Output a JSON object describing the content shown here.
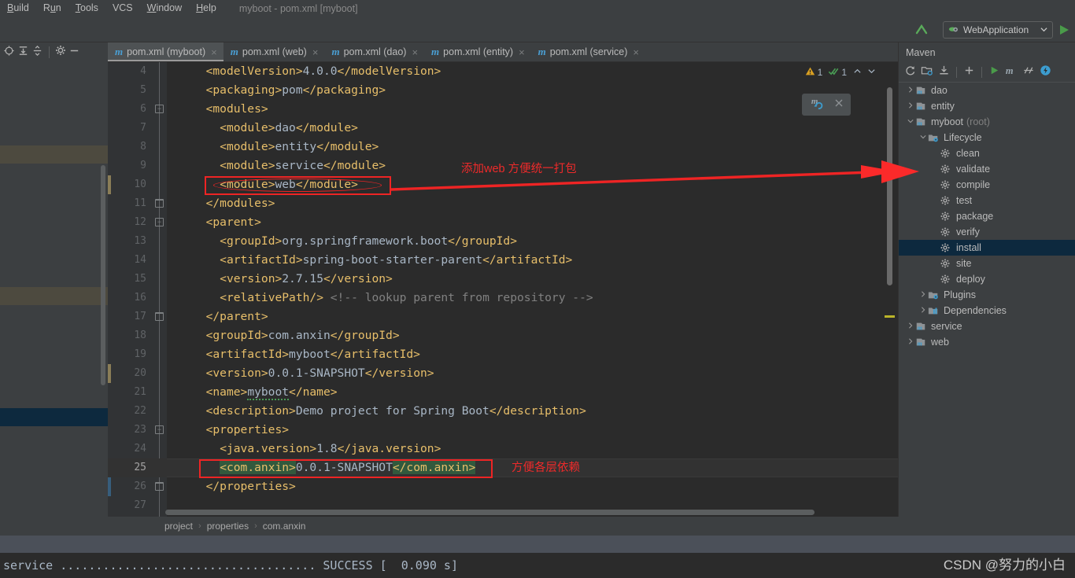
{
  "window": {
    "title": "myboot - pom.xml [myboot]",
    "menu": [
      "Build",
      "Run",
      "Tools",
      "VCS",
      "Window",
      "Help"
    ]
  },
  "toolbar": {
    "run_config": "WebApplication",
    "run_config_icon": "tomcat-icon",
    "dropdown_icon": "chevron-down-icon",
    "run_icon": "run-triangle-icon",
    "update_icon": "update-arrow-icon"
  },
  "left_toolbar": {
    "icons": [
      "locate-target-icon",
      "expand-all-icon",
      "collapse-all-icon",
      "gear-icon",
      "minimize-icon"
    ]
  },
  "editor_tabs": [
    {
      "label": "pom.xml (myboot)",
      "icon": "maven-m-icon",
      "active": true
    },
    {
      "label": "pom.xml (web)",
      "icon": "maven-m-icon",
      "active": false
    },
    {
      "label": "pom.xml (dao)",
      "icon": "maven-m-icon",
      "active": false
    },
    {
      "label": "pom.xml (entity)",
      "icon": "maven-m-icon",
      "active": false
    },
    {
      "label": "pom.xml (service)",
      "icon": "maven-m-icon",
      "active": false
    }
  ],
  "inspection": {
    "warning_icon": "warning-triangle-icon",
    "warning_count": "1",
    "ok_icon": "inspection-check-icon",
    "ok_count": "1",
    "prev_icon": "chevron-up-icon",
    "next_icon": "chevron-down-icon"
  },
  "maven_popup": {
    "reload_icon": "maven-reload-icon",
    "close_icon": "close-icon"
  },
  "code": {
    "first_line_number": 4,
    "lines": [
      {
        "n": 4,
        "indent": 2,
        "html": "<span class='tag'>&lt;modelVersion&gt;</span><span class='txt'>4.0.0</span><span class='tag'>&lt;/modelVersion&gt;</span>",
        "text": "<modelVersion>4.0.0</modelVersion>"
      },
      {
        "n": 5,
        "indent": 2,
        "html": "<span class='tag'>&lt;packaging&gt;</span><span class='txt'>pom</span><span class='tag'>&lt;/packaging&gt;</span>",
        "text": "<packaging>pom</packaging>"
      },
      {
        "n": 6,
        "indent": 2,
        "fold": "minus",
        "html": "<span class='tag'>&lt;modules&gt;</span>",
        "text": "<modules>"
      },
      {
        "n": 7,
        "indent": 4,
        "html": "<span class='tag'>&lt;module&gt;</span><span class='txt'>dao</span><span class='tag'>&lt;/module&gt;</span>",
        "text": "<module>dao</module>"
      },
      {
        "n": 8,
        "indent": 4,
        "html": "<span class='tag'>&lt;module&gt;</span><span class='txt'>entity</span><span class='tag'>&lt;/module&gt;</span>",
        "text": "<module>entity</module>"
      },
      {
        "n": 9,
        "indent": 4,
        "html": "<span class='tag'>&lt;module&gt;</span><span class='txt'>service</span><span class='tag'>&lt;/module&gt;</span>",
        "text": "<module>service</module>"
      },
      {
        "n": 10,
        "indent": 4,
        "html": "<span class='tag'>&lt;module&gt;</span><span class='txt'>web</span><span class='tag'>&lt;/module&gt;</span>",
        "text": "<module>web</module>"
      },
      {
        "n": 11,
        "indent": 2,
        "fold": "end",
        "html": "<span class='tag'>&lt;/modules&gt;</span>",
        "text": "</modules>"
      },
      {
        "n": 12,
        "indent": 2,
        "fold": "minus",
        "html": "<span class='tag'>&lt;parent&gt;</span>",
        "text": "<parent>"
      },
      {
        "n": 13,
        "indent": 4,
        "html": "<span class='tag'>&lt;groupId&gt;</span><span class='txt'>org.springframework.boot</span><span class='tag'>&lt;/groupId&gt;</span>",
        "text": "<groupId>org.springframework.boot</groupId>"
      },
      {
        "n": 14,
        "indent": 4,
        "html": "<span class='tag'>&lt;artifactId&gt;</span><span class='txt'>spring-boot-starter-parent</span><span class='tag'>&lt;/artifactId&gt;</span>",
        "text": "<artifactId>spring-boot-starter-parent</artifactId>"
      },
      {
        "n": 15,
        "indent": 4,
        "html": "<span class='tag'>&lt;version&gt;</span><span class='txt'>2.7.15</span><span class='tag'>&lt;/version&gt;</span>",
        "text": "<version>2.7.15</version>"
      },
      {
        "n": 16,
        "indent": 4,
        "html": "<span class='tag'>&lt;relativePath/&gt;</span><span class='cmt'> &lt;!-- lookup parent from repository --&gt;</span>",
        "text": "<relativePath/> <!-- lookup parent from repository -->"
      },
      {
        "n": 17,
        "indent": 2,
        "fold": "end",
        "html": "<span class='tag'>&lt;/parent&gt;</span>",
        "text": "</parent>"
      },
      {
        "n": 18,
        "indent": 2,
        "html": "<span class='tag'>&lt;groupId&gt;</span><span class='txt'>com.anxin</span><span class='tag'>&lt;/groupId&gt;</span>",
        "text": "<groupId>com.anxin</groupId>"
      },
      {
        "n": 19,
        "indent": 2,
        "html": "<span class='tag'>&lt;artifactId&gt;</span><span class='txt'>myboot</span><span class='tag'>&lt;/artifactId&gt;</span>",
        "text": "<artifactId>myboot</artifactId>"
      },
      {
        "n": 20,
        "indent": 2,
        "html": "<span class='tag'>&lt;version&gt;</span><span class='txt'>0.0.1-SNAPSHOT</span><span class='tag'>&lt;/version&gt;</span>",
        "text": "<version>0.0.1-SNAPSHOT</version>"
      },
      {
        "n": 21,
        "indent": 2,
        "html": "<span class='tag'>&lt;name&gt;</span><span class='txt squig'>myboot</span><span class='tag'>&lt;/name&gt;</span>",
        "text": "<name>myboot</name>"
      },
      {
        "n": 22,
        "indent": 2,
        "html": "<span class='tag'>&lt;description&gt;</span><span class='txt'>Demo project for Spring Boot</span><span class='tag'>&lt;/description&gt;</span>",
        "text": "<description>Demo project for Spring Boot</description>"
      },
      {
        "n": 23,
        "indent": 2,
        "fold": "minus",
        "html": "<span class='tag'>&lt;properties&gt;</span>",
        "text": "<properties>"
      },
      {
        "n": 24,
        "indent": 4,
        "html": "<span class='tag'>&lt;java.version&gt;</span><span class='txt'>1.8</span><span class='tag'>&lt;/java.version&gt;</span>",
        "text": "<java.version>1.8</java.version>"
      },
      {
        "n": 25,
        "indent": 4,
        "current": true,
        "html": "<span class='tag sel'>&lt;com.anxin&gt;</span><span class='txt'>0.0.1-SNAPSHOT</span><span class='tag sel'>&lt;/com.anxin&gt;</span>",
        "text": "<com.anxin>0.0.1-SNAPSHOT</com.anxin>"
      },
      {
        "n": 26,
        "indent": 2,
        "fold": "end",
        "html": "<span class='tag'>&lt;/properties&gt;</span>",
        "text": "</properties>"
      },
      {
        "n": 27,
        "indent": 2,
        "html": "",
        "text": ""
      }
    ]
  },
  "breadcrumb": [
    "project",
    "properties",
    "com.anxin"
  ],
  "maven": {
    "title": "Maven",
    "toolbar_icons": [
      "reload-all-icon",
      "generate-sources-icon",
      "download-sources-icon",
      "add-icon",
      "run-icon",
      "maven-m-icon",
      "toggle-skip-tests-icon",
      "execute-goal-icon"
    ],
    "tree": [
      {
        "label": "dao",
        "dim": "",
        "icon": "maven-project-icon",
        "arrow": "right",
        "depth": 0,
        "selected": false
      },
      {
        "label": "entity",
        "dim": "",
        "icon": "maven-project-icon",
        "arrow": "right",
        "depth": 0,
        "selected": false
      },
      {
        "label": "myboot",
        "dim": "(root)",
        "icon": "maven-project-icon",
        "arrow": "down",
        "depth": 0,
        "selected": false
      },
      {
        "label": "Lifecycle",
        "dim": "",
        "icon": "lifecycle-folder-icon",
        "arrow": "down",
        "depth": 1,
        "selected": false
      },
      {
        "label": "clean",
        "dim": "",
        "icon": "goal-gear-icon",
        "arrow": "none",
        "depth": 2,
        "selected": false
      },
      {
        "label": "validate",
        "dim": "",
        "icon": "goal-gear-icon",
        "arrow": "none",
        "depth": 2,
        "selected": false
      },
      {
        "label": "compile",
        "dim": "",
        "icon": "goal-gear-icon",
        "arrow": "none",
        "depth": 2,
        "selected": false
      },
      {
        "label": "test",
        "dim": "",
        "icon": "goal-gear-icon",
        "arrow": "none",
        "depth": 2,
        "selected": false
      },
      {
        "label": "package",
        "dim": "",
        "icon": "goal-gear-icon",
        "arrow": "none",
        "depth": 2,
        "selected": false
      },
      {
        "label": "verify",
        "dim": "",
        "icon": "goal-gear-icon",
        "arrow": "none",
        "depth": 2,
        "selected": false
      },
      {
        "label": "install",
        "dim": "",
        "icon": "goal-gear-icon",
        "arrow": "none",
        "depth": 2,
        "selected": true
      },
      {
        "label": "site",
        "dim": "",
        "icon": "goal-gear-icon",
        "arrow": "none",
        "depth": 2,
        "selected": false
      },
      {
        "label": "deploy",
        "dim": "",
        "icon": "goal-gear-icon",
        "arrow": "none",
        "depth": 2,
        "selected": false
      },
      {
        "label": "Plugins",
        "dim": "",
        "icon": "plugins-folder-icon",
        "arrow": "right",
        "depth": 1,
        "selected": false
      },
      {
        "label": "Dependencies",
        "dim": "",
        "icon": "dependencies-icon",
        "arrow": "right",
        "depth": 1,
        "selected": false
      },
      {
        "label": "service",
        "dim": "",
        "icon": "maven-project-icon",
        "arrow": "right",
        "depth": 0,
        "selected": false
      },
      {
        "label": "web",
        "dim": "",
        "icon": "maven-project-icon",
        "arrow": "right",
        "depth": 0,
        "selected": false
      }
    ]
  },
  "console": {
    "line": "service .................................... SUCCESS [  0.090 s]"
  },
  "watermark": "CSDN @努力的小白",
  "annotations": [
    {
      "id": "note-add-web",
      "text": "添加web 方便统一打包",
      "color": "#ef2a2a"
    },
    {
      "id": "note-layer-dep",
      "text": "方便各层依赖",
      "color": "#ef2a2a"
    }
  ],
  "colors": {
    "accent_red": "#ee2424",
    "tag": "#e8bf6a",
    "value": "#a9b7c6",
    "comment": "#808080",
    "selection": "#32593d",
    "tree_selected": "#0d293e",
    "editor_bg": "#2b2b2b",
    "ui_bg": "#3c3f41"
  }
}
